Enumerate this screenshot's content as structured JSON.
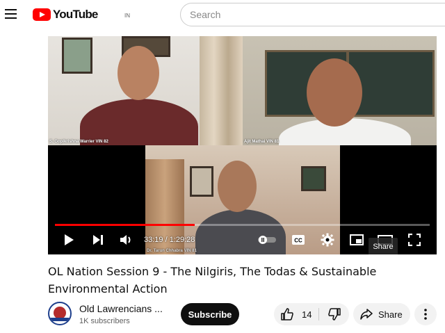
{
  "header": {
    "logo_text": "YouTube",
    "country_code": "IN",
    "search_placeholder": "Search",
    "menu_icon": "hamburger-icon"
  },
  "player": {
    "participants": [
      {
        "caption": "S. Gopikrishna Warrier VIN 82"
      },
      {
        "caption": "Ajit Mathai VIN 81"
      },
      {
        "caption": "Dr. Tarun Chhabra VIN 81"
      }
    ],
    "current_time": "33:19",
    "separator": " / ",
    "duration": "1:29:28",
    "progress_fraction": 0.372,
    "share_tooltip": "Share",
    "accent_color": "#ff0000"
  },
  "video": {
    "title": "OL Nation Session 9 - The Nilgiris, The Todas & Sustainable Environmental Action",
    "channel_name": "Old Lawrencians ...",
    "subscribers": "1K subscribers",
    "subscribe_label": "Subscribe",
    "like_count": "14",
    "share_label": "Share"
  }
}
